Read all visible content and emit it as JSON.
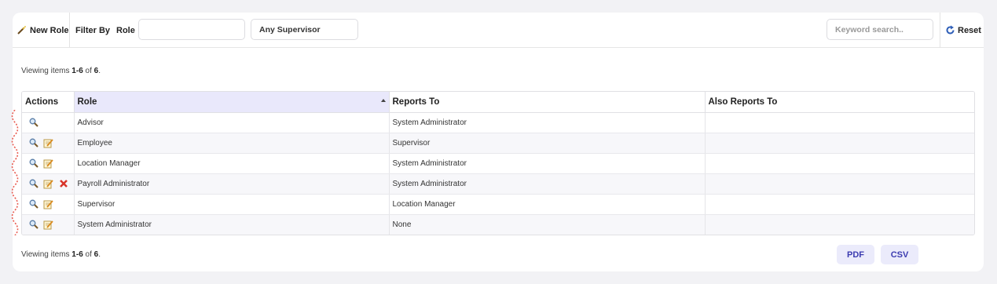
{
  "toolbar": {
    "new_role_label": "New Role",
    "filter_by_label": "Filter By",
    "role_label": "Role",
    "role_value": "",
    "supervisor_value": "Any Supervisor",
    "keyword_placeholder": "Keyword search..",
    "reset_label": "Reset"
  },
  "viewing_top": {
    "prefix": "Viewing items ",
    "range": "1-6",
    "mid": " of ",
    "total": "6",
    "suffix": "."
  },
  "viewing_bottom": {
    "prefix": "Viewing items ",
    "range": "1-6",
    "mid": " of ",
    "total": "6",
    "suffix": "."
  },
  "table": {
    "headers": {
      "actions": "Actions",
      "role": "Role",
      "reports_to": "Reports To",
      "also_reports_to": "Also Reports To"
    },
    "rows": [
      {
        "actions": [
          "view-icon"
        ],
        "role": "Advisor",
        "reports_to": "System Administrator",
        "also_reports_to": ""
      },
      {
        "actions": [
          "view-icon",
          "edit-icon"
        ],
        "role": "Employee",
        "reports_to": "Supervisor",
        "also_reports_to": ""
      },
      {
        "actions": [
          "view-icon",
          "edit-icon"
        ],
        "role": "Location Manager",
        "reports_to": "System Administrator",
        "also_reports_to": ""
      },
      {
        "actions": [
          "view-icon",
          "edit-icon",
          "delete-icon"
        ],
        "role": "Payroll Administrator",
        "reports_to": "System Administrator",
        "also_reports_to": ""
      },
      {
        "actions": [
          "view-icon",
          "edit-icon"
        ],
        "role": "Supervisor",
        "reports_to": "Location Manager",
        "also_reports_to": ""
      },
      {
        "actions": [
          "view-icon",
          "edit-icon"
        ],
        "role": "System Administrator",
        "reports_to": "None",
        "also_reports_to": ""
      }
    ]
  },
  "export": {
    "pdf_label": "PDF",
    "csv_label": "CSV"
  },
  "colors": {
    "accent": "#3b3bb0",
    "sorted_header": "#e9e8fb",
    "button_bg": "#ebebfb"
  }
}
